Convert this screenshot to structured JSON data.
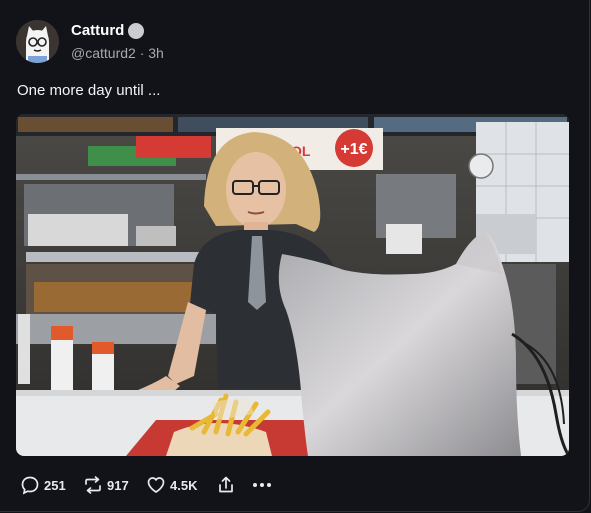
{
  "post": {
    "author": {
      "display_name": "Catturd",
      "handle": "@catturd2",
      "time_ago": "3h",
      "verified_icon": "verified-badge-icon",
      "avatar_icon": "cartoon-cat-avatar-icon"
    },
    "text": "One more day until ...",
    "media": {
      "sign_price": "+1€",
      "sign_text": "SOL",
      "icon": "photo-fast-food-counter-with-cat-ears"
    },
    "actions": {
      "reply_count": "251",
      "repost_count": "917",
      "like_count": "4.5K",
      "reply_icon": "reply-icon",
      "repost_icon": "repost-icon",
      "like_icon": "heart-icon",
      "share_icon": "share-icon",
      "more_icon": "more-dots-icon"
    }
  },
  "colors": {
    "background": "#121318",
    "text_primary": "#ffffff",
    "text_secondary": "#a4a9b1",
    "sign_red": "#d63a34"
  }
}
